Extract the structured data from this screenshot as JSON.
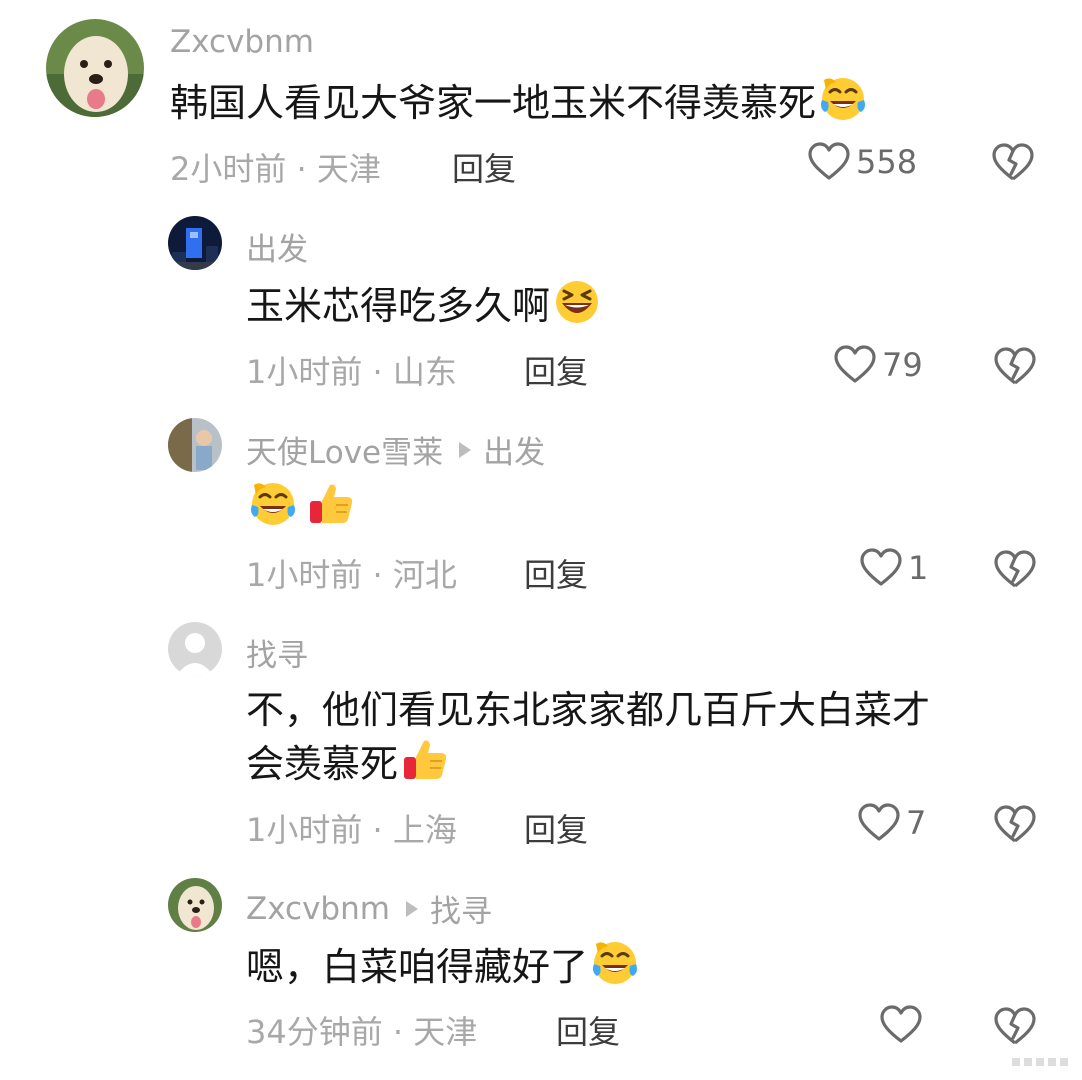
{
  "comments": [
    {
      "username": "Zxcvbnm",
      "reply_to": "",
      "text": "韩国人看见大爷家一地玉米不得羡慕死",
      "emojis": [
        "laughing-tears"
      ],
      "time": "2小时前",
      "location": "天津",
      "reply_label": "回复",
      "likes": "558"
    },
    {
      "username": "出发",
      "reply_to": "",
      "text": "玉米芯得吃多久啊",
      "emojis": [
        "grinning-squint"
      ],
      "time": "1小时前",
      "location": "山东",
      "reply_label": "回复",
      "likes": "79"
    },
    {
      "username": "天使Love雪莱",
      "reply_to": "出发",
      "text": "",
      "emojis": [
        "laughing-tears",
        "thumbs-up"
      ],
      "time": "1小时前",
      "location": "河北",
      "reply_label": "回复",
      "likes": "1"
    },
    {
      "username": "找寻",
      "reply_to": "",
      "text_line1": "不，他们看见东北家家都几百斤大白菜才",
      "text_line2": "会羡慕死",
      "emojis": [
        "thumbs-up"
      ],
      "time": "1小时前",
      "location": "上海",
      "reply_label": "回复",
      "likes": "7"
    },
    {
      "username": "Zxcvbnm",
      "reply_to": "找寻",
      "text": "嗯，白菜咱得藏好了",
      "emojis": [
        "laughing-tears"
      ],
      "time": "34分钟前",
      "location": "天津",
      "reply_label": "回复",
      "likes": ""
    }
  ],
  "meta_separator": " · ",
  "colors": {
    "username": "#a3a3a3",
    "text": "#161616",
    "meta": "#a8a8a8",
    "icon": "#6b6b6b"
  }
}
